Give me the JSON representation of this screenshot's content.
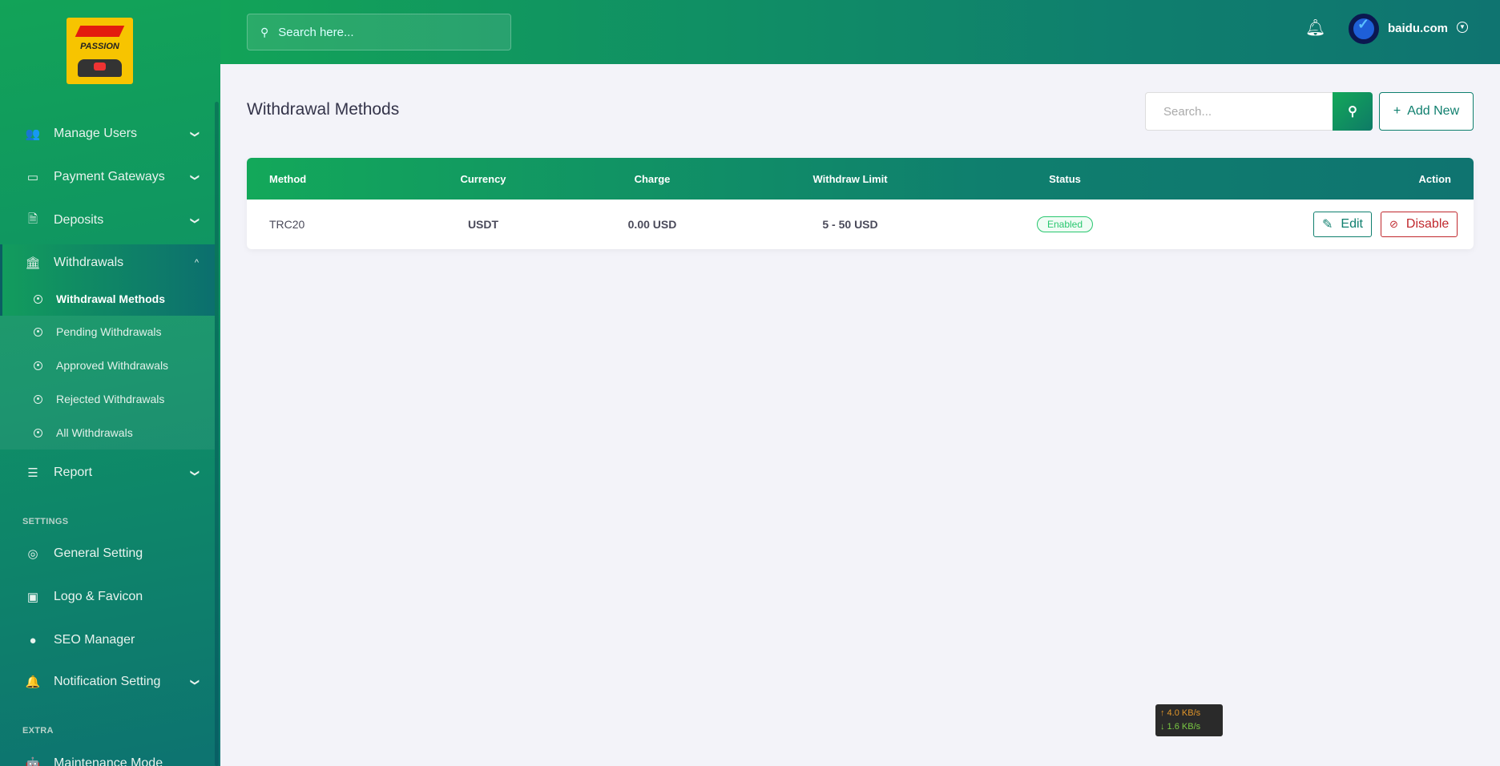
{
  "sidebar": {
    "logo_text": "F1 PASSION",
    "items": [
      {
        "label": "Manage Users",
        "icon": "users-icon"
      },
      {
        "label": "Payment Gateways",
        "icon": "credit-card-icon"
      },
      {
        "label": "Deposits",
        "icon": "invoice-icon"
      },
      {
        "label": "Withdrawals",
        "icon": "bank-icon"
      },
      {
        "label": "Report",
        "icon": "list-icon"
      }
    ],
    "withdrawals_sub": [
      "Withdrawal Methods",
      "Pending Withdrawals",
      "Approved Withdrawals",
      "Rejected Withdrawals",
      "All Withdrawals"
    ],
    "settings_label": "SETTINGS",
    "settings": [
      {
        "label": "General Setting",
        "icon": "lifebuoy-icon"
      },
      {
        "label": "Logo & Favicon",
        "icon": "images-icon"
      },
      {
        "label": "SEO Manager",
        "icon": "globe-icon"
      },
      {
        "label": "Notification Setting",
        "icon": "bell-icon"
      }
    ],
    "extra_label": "EXTRA",
    "extra": [
      {
        "label": "Maintenance Mode",
        "icon": "robot-icon"
      }
    ]
  },
  "topbar": {
    "search_placeholder": "Search here...",
    "username": "baidu.com"
  },
  "page": {
    "title": "Withdrawal Methods",
    "search_placeholder": "Search...",
    "add_new": "Add New"
  },
  "table": {
    "headers": [
      "Method",
      "Currency",
      "Charge",
      "Withdraw Limit",
      "Status",
      "Action"
    ],
    "rows": [
      {
        "method": "TRC20",
        "currency": "USDT",
        "charge": "0.00 USD",
        "limit": "5 - 50 USD",
        "status": "Enabled",
        "edit": "Edit",
        "disable": "Disable"
      }
    ]
  },
  "speed": {
    "up": "↑ 4.0 KB/s",
    "down": "↓ 1.6 KB/s"
  },
  "colors": {
    "primary": "#12a358",
    "secondary": "#0f7470",
    "danger": "#c0282d",
    "success": "#28c76f"
  }
}
